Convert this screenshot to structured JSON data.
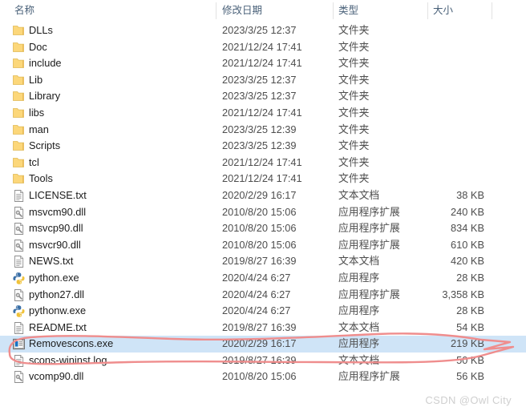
{
  "columns": {
    "name": "名称",
    "date": "修改日期",
    "type": "类型",
    "size": "大小"
  },
  "types": {
    "folder": "文件夹",
    "text": "文本文档",
    "dll": "应用程序扩展",
    "app": "应用程序"
  },
  "rows": [
    {
      "name": "DLLs",
      "date": "2023/3/25 12:37",
      "type": "文件夹",
      "size": "",
      "icon": "folder-icon",
      "selected": false
    },
    {
      "name": "Doc",
      "date": "2021/12/24 17:41",
      "type": "文件夹",
      "size": "",
      "icon": "folder-icon",
      "selected": false
    },
    {
      "name": "include",
      "date": "2021/12/24 17:41",
      "type": "文件夹",
      "size": "",
      "icon": "folder-icon",
      "selected": false
    },
    {
      "name": "Lib",
      "date": "2023/3/25 12:37",
      "type": "文件夹",
      "size": "",
      "icon": "folder-icon",
      "selected": false
    },
    {
      "name": "Library",
      "date": "2023/3/25 12:37",
      "type": "文件夹",
      "size": "",
      "icon": "folder-icon",
      "selected": false
    },
    {
      "name": "libs",
      "date": "2021/12/24 17:41",
      "type": "文件夹",
      "size": "",
      "icon": "folder-icon",
      "selected": false
    },
    {
      "name": "man",
      "date": "2023/3/25 12:39",
      "type": "文件夹",
      "size": "",
      "icon": "folder-icon",
      "selected": false
    },
    {
      "name": "Scripts",
      "date": "2023/3/25 12:39",
      "type": "文件夹",
      "size": "",
      "icon": "folder-icon",
      "selected": false
    },
    {
      "name": "tcl",
      "date": "2021/12/24 17:41",
      "type": "文件夹",
      "size": "",
      "icon": "folder-icon",
      "selected": false
    },
    {
      "name": "Tools",
      "date": "2021/12/24 17:41",
      "type": "文件夹",
      "size": "",
      "icon": "folder-icon",
      "selected": false
    },
    {
      "name": "LICENSE.txt",
      "date": "2020/2/29 16:17",
      "type": "文本文档",
      "size": "38 KB",
      "icon": "text-file-icon",
      "selected": false
    },
    {
      "name": "msvcm90.dll",
      "date": "2010/8/20 15:06",
      "type": "应用程序扩展",
      "size": "240 KB",
      "icon": "dll-file-icon",
      "selected": false
    },
    {
      "name": "msvcp90.dll",
      "date": "2010/8/20 15:06",
      "type": "应用程序扩展",
      "size": "834 KB",
      "icon": "dll-file-icon",
      "selected": false
    },
    {
      "name": "msvcr90.dll",
      "date": "2010/8/20 15:06",
      "type": "应用程序扩展",
      "size": "610 KB",
      "icon": "dll-file-icon",
      "selected": false
    },
    {
      "name": "NEWS.txt",
      "date": "2019/8/27 16:39",
      "type": "文本文档",
      "size": "420 KB",
      "icon": "text-file-icon",
      "selected": false
    },
    {
      "name": "python.exe",
      "date": "2020/4/24 6:27",
      "type": "应用程序",
      "size": "28 KB",
      "icon": "python-icon",
      "selected": false
    },
    {
      "name": "python27.dll",
      "date": "2020/4/24 6:27",
      "type": "应用程序扩展",
      "size": "3,358 KB",
      "icon": "dll-file-icon",
      "selected": false
    },
    {
      "name": "pythonw.exe",
      "date": "2020/4/24 6:27",
      "type": "应用程序",
      "size": "28 KB",
      "icon": "python-icon",
      "selected": false
    },
    {
      "name": "README.txt",
      "date": "2019/8/27 16:39",
      "type": "文本文档",
      "size": "54 KB",
      "icon": "text-file-icon",
      "selected": false
    },
    {
      "name": "Removescons.exe",
      "date": "2020/2/29 16:17",
      "type": "应用程序",
      "size": "219 KB",
      "icon": "app-window-icon",
      "selected": true
    },
    {
      "name": "scons-wininst.log",
      "date": "2019/8/27 16:39",
      "type": "文本文档",
      "size": "50 KB",
      "icon": "text-file-icon",
      "selected": false
    },
    {
      "name": "vcomp90.dll",
      "date": "2010/8/20 15:06",
      "type": "应用程序扩展",
      "size": "56 KB",
      "icon": "dll-file-icon",
      "selected": false
    }
  ],
  "annotation": {
    "color": "#ef8d8d",
    "shape": "hand-drawn-ellipse-with-arrow"
  },
  "watermark": "CSDN @Owl  City",
  "colors": {
    "selection": "#cfe4f7",
    "header_text": "#4a6179",
    "folder": "#fcd77a",
    "annotation": "#ef8d8d"
  }
}
